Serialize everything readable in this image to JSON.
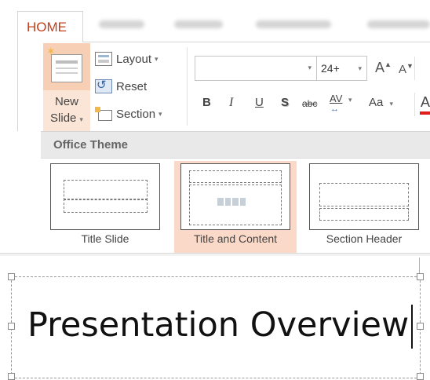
{
  "ribbon": {
    "active_tab": "HOME",
    "slides_group": {
      "new_slide_label_line1": "New",
      "new_slide_label_line2": "Slide",
      "layout_label": "Layout",
      "reset_label": "Reset",
      "section_label": "Section"
    },
    "font_group": {
      "font_name_value": "",
      "font_size_value": "24+",
      "grow_font": "A",
      "shrink_font": "A",
      "bold": "B",
      "italic": "I",
      "underline": "U",
      "shadow": "S",
      "strikethrough": "abc",
      "char_spacing": "AV",
      "change_case": "Aa",
      "font_color": "A"
    }
  },
  "layout_gallery": {
    "header": "Office Theme",
    "layouts": [
      {
        "label": "Title Slide",
        "selected": false
      },
      {
        "label": "Title and Content",
        "selected": true
      },
      {
        "label": "Section Header",
        "selected": false
      }
    ]
  },
  "slide": {
    "title_text": "Presentation Overview"
  },
  "colors": {
    "accent_tab": "#c43e1c",
    "selection_fill": "#fbd9c8",
    "font_color_bar": "#e01b1b"
  }
}
